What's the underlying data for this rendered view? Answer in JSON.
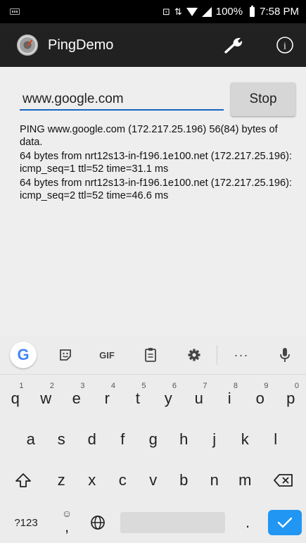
{
  "status_bar": {
    "sim_indicator": "⊡",
    "data_indicator": "⇅",
    "battery_percent": "100%",
    "time": "7:58 PM"
  },
  "app_bar": {
    "title": "PingDemo",
    "settings_icon": "wrench-icon",
    "info_icon": "info-icon",
    "info_glyph": "i"
  },
  "main": {
    "host_input": {
      "value": "www.google.com",
      "placeholder": ""
    },
    "stop_label": "Stop",
    "output": [
      "PING www.google.com (172.217.25.196) 56(84) bytes of data.",
      "64 bytes from nrt12s13-in-f196.1e100.net (172.217.25.196): icmp_seq=1 ttl=52 time=31.1 ms",
      "64 bytes from nrt12s13-in-f196.1e100.net (172.217.25.196): icmp_seq=2 ttl=52 time=46.6 ms"
    ]
  },
  "keyboard": {
    "suggestions": {
      "google": "G",
      "sticker_icon": "sticker-icon",
      "gif": "GIF",
      "clipboard_icon": "clipboard-icon",
      "settings_icon": "gear-icon",
      "more": "···",
      "mic_icon": "mic-icon"
    },
    "row1": [
      {
        "k": "q",
        "h": "1"
      },
      {
        "k": "w",
        "h": "2"
      },
      {
        "k": "e",
        "h": "3"
      },
      {
        "k": "r",
        "h": "4"
      },
      {
        "k": "t",
        "h": "5"
      },
      {
        "k": "y",
        "h": "6"
      },
      {
        "k": "u",
        "h": "7"
      },
      {
        "k": "i",
        "h": "8"
      },
      {
        "k": "o",
        "h": "9"
      },
      {
        "k": "p",
        "h": "0"
      }
    ],
    "row2": [
      "a",
      "s",
      "d",
      "f",
      "g",
      "h",
      "j",
      "k",
      "l"
    ],
    "row3": [
      "z",
      "x",
      "c",
      "v",
      "b",
      "n",
      "m"
    ],
    "symbols_label": "?123",
    "emoji_key": "☺",
    "comma_key": ",",
    "period_key": "."
  }
}
